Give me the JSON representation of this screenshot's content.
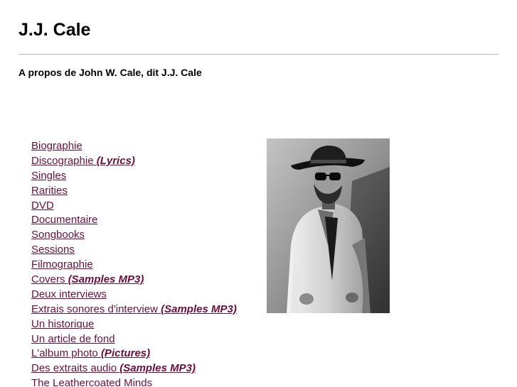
{
  "header": {
    "title": "J.J. Cale",
    "subtitle": "A propos de John W. Cale, dit J.J. Cale"
  },
  "nav": {
    "items": [
      {
        "label": "Biographie",
        "extra": ""
      },
      {
        "label": "Discographie",
        "extra": "(Lyrics)"
      },
      {
        "label": "Singles",
        "extra": ""
      },
      {
        "label": "Rarities",
        "extra": ""
      },
      {
        "label": "DVD",
        "extra": ""
      },
      {
        "label": "Documentaire",
        "extra": ""
      },
      {
        "label": "Songbooks",
        "extra": ""
      },
      {
        "label": "Sessions",
        "extra": ""
      },
      {
        "label": "Filmographie",
        "extra": ""
      },
      {
        "label": "Covers",
        "extra": "(Samples MP3)"
      },
      {
        "label": "Deux interviews",
        "extra": ""
      },
      {
        "label": "Extrais sonores d'interview",
        "extra": "(Samples MP3)"
      },
      {
        "label": "Un historique",
        "extra": ""
      },
      {
        "label": "Un article de fond",
        "extra": ""
      },
      {
        "label": "L'album photo",
        "extra": "(Pictures)"
      },
      {
        "label": "Des extraits audio",
        "extra": "(Samples MP3)"
      },
      {
        "label": "The Leathercoated Minds",
        "extra": ""
      }
    ]
  },
  "colors": {
    "link": "#6b0f3a",
    "divider": "#b8b8b8"
  }
}
